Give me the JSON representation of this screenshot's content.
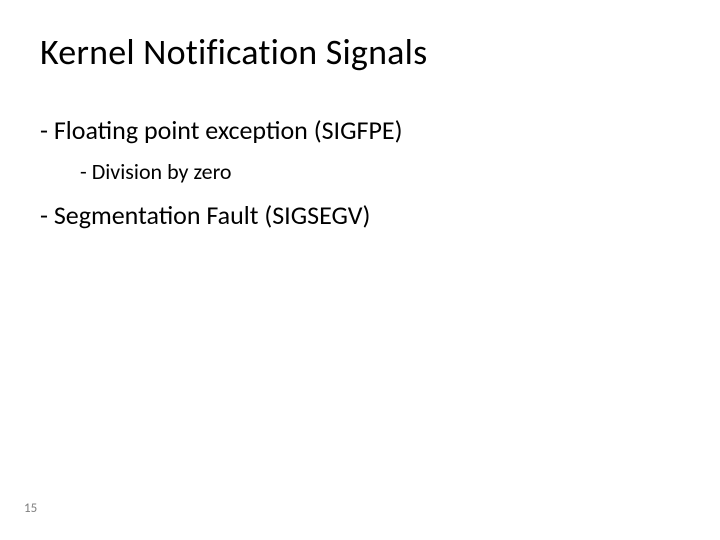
{
  "title": "Kernel Notification Signals",
  "bullets": {
    "item0": "Floating point exception (SIGFPE)",
    "item0_sub0": "Division by zero",
    "item1": "Segmentation Fault (SIGSEGV)"
  },
  "page_number": "15"
}
